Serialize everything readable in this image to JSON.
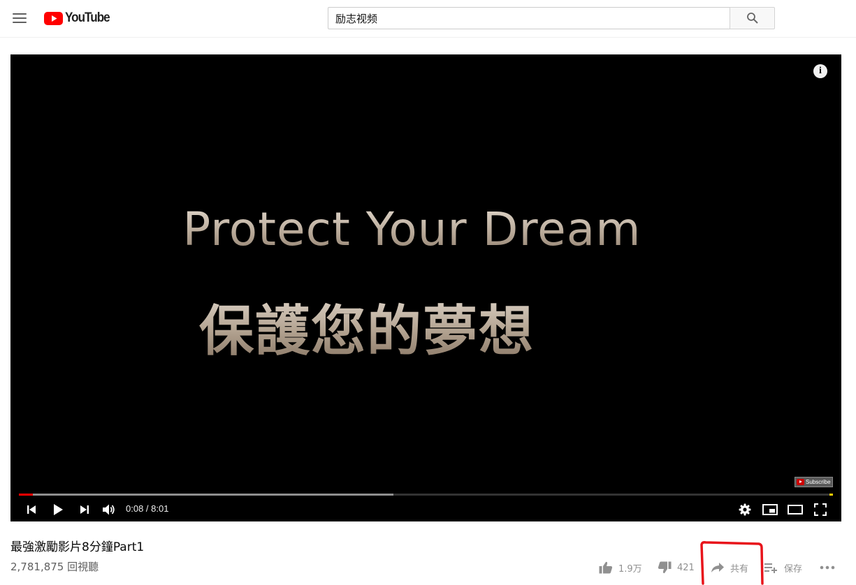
{
  "header": {
    "logo_text": "YouTube",
    "search_value": "励志视频"
  },
  "player": {
    "overlay_line1": "Protect Your Dream",
    "overlay_line2": "保護您的夢想",
    "watermark_label": "Subscribe",
    "time_display": "0:08 / 8:01",
    "played_fraction": 0.017,
    "loaded_fraction": 0.46
  },
  "video": {
    "title": "最強激勵影片8分鐘Part1",
    "views": "2,781,875 回視聽"
  },
  "actions": {
    "like_count": "1.9万",
    "dislike_count": "421",
    "share_label": "共有",
    "save_label": "保存"
  },
  "colors": {
    "brand_red": "#ff0000",
    "annotation_red": "#e8141b"
  }
}
